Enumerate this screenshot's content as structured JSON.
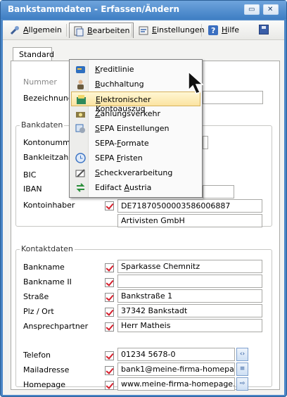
{
  "window": {
    "title": "Bankstammdaten - Erfassen/Ändern",
    "min_glyph": "▭",
    "close_glyph": "✕"
  },
  "menubar": {
    "items": [
      {
        "label": "Allgemein",
        "accel": "A",
        "icon": "wrench-icon"
      },
      {
        "label": "Bearbeiten",
        "accel": "B",
        "icon": "document-icon"
      },
      {
        "label": "Einstellungen",
        "accel": "E",
        "icon": "settings-icon"
      },
      {
        "label": "Hilfe",
        "accel": "H",
        "icon": "help-icon"
      }
    ],
    "save_icon": "save-icon"
  },
  "tab": {
    "label": "Standard"
  },
  "basics": {
    "nummer_label": "Nummer",
    "bezeichnung_label": "Bezeichnung",
    "bezeichnung_value": ""
  },
  "bankdaten": {
    "legend": "Bankdaten",
    "rows": [
      {
        "label": "Kontonummer",
        "visible_label": "Kontonumm",
        "value": ""
      },
      {
        "label": "Bankleitzahl",
        "visible_label": "Bankleitzahl",
        "value": ""
      },
      {
        "label": "BIC",
        "visible_label": "BIC",
        "value": ""
      },
      {
        "label": "IBAN",
        "visible_label": "IBAN",
        "value": "DE71870500003586006887"
      },
      {
        "label": "Kontoinhaber",
        "visible_label": "Kontoinhaber",
        "value": "Artivisten GmbH"
      }
    ]
  },
  "kontaktdaten": {
    "legend": "Kontaktdaten",
    "rows": [
      {
        "label": "Bankname",
        "value": "Sparkasse Chemnitz"
      },
      {
        "label": "Bankname II",
        "value": ""
      },
      {
        "label": "Straße",
        "value": "Bankstraße 1"
      },
      {
        "label": "Plz / Ort",
        "value": "37342 Bankstadt"
      },
      {
        "label": "Ansprechpartner",
        "value": "Herr Matheis"
      },
      {
        "label": "Telefon",
        "value": "01234 5678-0",
        "button_glyph": "‹›"
      },
      {
        "label": "Mailadresse",
        "value": "bank1@meine-firma-homepage.de",
        "button_glyph": "≡"
      },
      {
        "label": "Homepage",
        "value": "www.meine-firma-homepage.de",
        "button_glyph": "⇨"
      }
    ]
  },
  "dropdown": {
    "highlighted_index": 2,
    "items": [
      {
        "label": "Kreditlinie",
        "accel": "K",
        "icon": "credit-line-icon",
        "color": "#2f6fbf"
      },
      {
        "label": "Buchhaltung",
        "accel": "B",
        "icon": "accountant-icon",
        "color": "#6a5b3f"
      },
      {
        "label": "Elektronischer Kontoauszug",
        "accel": "E",
        "icon": "bank-statement-icon",
        "color": "#2f8a5b"
      },
      {
        "label": "Zahlungsverkehr",
        "accel": "Z",
        "icon": "payment-icon",
        "color": "#8a7a44"
      },
      {
        "label": "SEPA Einstellungen",
        "accel": "S",
        "icon": "sepa-settings-icon",
        "color": "#3d6fb3"
      },
      {
        "label": "SEPA-Formate",
        "accel": "F",
        "icon": "",
        "color": ""
      },
      {
        "label": "SEPA Fristen",
        "accel": "F",
        "icon": "clock-icon",
        "color": "#3c74c4"
      },
      {
        "label": "Scheckverarbeitung",
        "accel": "S",
        "icon": "cheque-pen-icon",
        "color": "#555555"
      },
      {
        "label": "Edifact Austria",
        "accel": "A",
        "icon": "exchange-arrows-icon",
        "color": "#2a8f3a"
      }
    ]
  },
  "colors": {
    "titlebar": "#4a86c7",
    "check_red": "#d51e2c",
    "highlight": "#fbe3a1"
  }
}
